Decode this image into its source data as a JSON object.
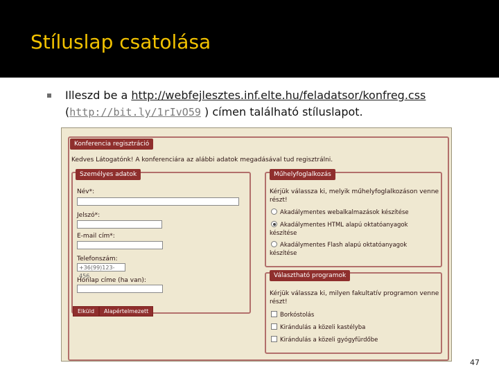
{
  "slide": {
    "title": "Stíluslap csatolása",
    "bullet": {
      "prefix": "Illeszd be a ",
      "url": "http://webfejlesztes.inf.elte.hu/feladatsor/konfreg.css",
      "short_open": "(",
      "short_url": "http://bit.ly/1rIvO59",
      "suffix": " ) címen található stíluslapot."
    },
    "page_number": "47"
  },
  "form": {
    "main_legend": "Konferencia regisztráció",
    "intro": "Kedves Látogatónk! A konferenciára az alábbi adatok megadásával tud regisztrálni.",
    "personal": {
      "legend": "Személyes adatok",
      "name_label": "Név*:",
      "password_label": "Jelszó*:",
      "email_label": "E-mail cím*:",
      "phone_label": "Telefonszám:",
      "phone_placeholder": "+36(99)123-456",
      "homepage_label": "Honlap címe (ha van):"
    },
    "workshop": {
      "legend": "Műhelyfoglalkozás",
      "question_1": "Kérjük válassza ki, melyik műhelyfoglalkozáson venne",
      "question_2": "részt!",
      "options": [
        "Akadálymentes webalkalmazások készítése",
        "Akadálymentes HTML alapú oktatóanyagok",
        "készítése",
        "Akadálymentes Flash alapú oktatóanyagok",
        "készítése"
      ]
    },
    "programs": {
      "legend": "Választható programok",
      "question_1": "Kérjük válassza ki, milyen fakultatív programon venne",
      "question_2": "részt!",
      "options": [
        "Borkóstolás",
        "Kirándulás a közeli kastélyba",
        "Kirándulás a közeli gyógyfürdőbe"
      ]
    },
    "buttons": {
      "submit": "Elküld",
      "reset": "Alapértelmezett"
    }
  },
  "colors": {
    "title": "#f2c200",
    "legend_bg": "#8f2f2d",
    "panel_border": "#b26f6b",
    "form_bg": "#efe8d1"
  }
}
